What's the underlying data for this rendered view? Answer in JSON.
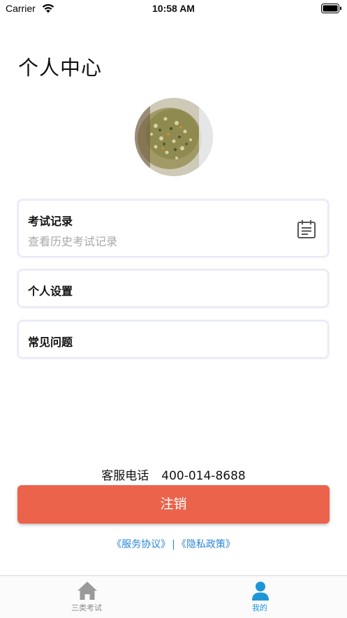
{
  "status_bar": {
    "carrier": "Carrier",
    "time": "10:58 AM"
  },
  "page": {
    "title": "个人中心"
  },
  "menu": {
    "exam_records": {
      "title": "考试记录",
      "subtitle": "查看历史考试记录",
      "icon": "calendar-icon"
    },
    "personal_settings": {
      "title": "个人设置"
    },
    "faq": {
      "title": "常见问题"
    }
  },
  "service": {
    "label": "客服电话",
    "phone": "400-014-8688"
  },
  "logout": {
    "label": "注销",
    "color": "#eb634b"
  },
  "agreements": {
    "service": "《服务协议》",
    "separator": "|",
    "privacy": "《隐私政策》",
    "color": "#2b86d8"
  },
  "tab_bar": {
    "tabs": [
      {
        "label": "三类考试",
        "icon": "home-icon",
        "active": false
      },
      {
        "label": "我的",
        "icon": "user-icon",
        "active": true
      }
    ],
    "active_color": "#1d96d8"
  }
}
